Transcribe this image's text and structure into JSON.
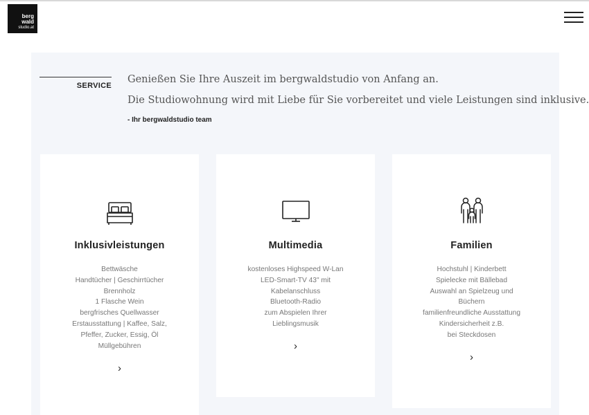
{
  "logo": {
    "line1": "berg",
    "line2": "wald",
    "line3": "studio.at"
  },
  "header": {
    "menu_icon": "hamburger-menu-icon"
  },
  "service": {
    "label": "SERVICE",
    "intro_line1": "Genießen Sie Ihre Auszeit im bergwaldstudio von Anfang an.",
    "intro_line2": "Die Studiowohnung wird mit Liebe für Sie vorbereitet und viele Leistungen sind inklusive.",
    "signature": "- Ihr bergwaldstudio team"
  },
  "cards": [
    {
      "icon": "bed-icon",
      "title": "Inklusivleistungen",
      "features": [
        "Bettwäsche",
        "Handtücher | Geschirrtücher",
        "Brennholz",
        "1 Flasche Wein",
        "bergfrisches Quellwasser",
        "Erstausstattung | Kaffee, Salz,",
        "Pfeffer, Zucker, Essig, Öl",
        "Müllgebühren"
      ],
      "arrow": "›"
    },
    {
      "icon": "tv-icon",
      "title": "Multimedia",
      "features": [
        "kostenloses Highspeed W-Lan",
        "LED-Smart-TV 43\" mit",
        "Kabelanschluss",
        "Bluetooth-Radio",
        "zum Abspielen Ihrer",
        "Lieblingsmusik"
      ],
      "arrow": "›"
    },
    {
      "icon": "family-icon",
      "title": "Familien",
      "features": [
        "Hochstuhl | Kinderbett",
        "Spielecke mit Bällebad",
        "Auswahl an Spielzeug und",
        "Büchern",
        "familienfreundliche Ausstattung",
        "Kindersicherheit z.B.",
        "bei Steckdosen"
      ],
      "arrow": "›"
    }
  ]
}
